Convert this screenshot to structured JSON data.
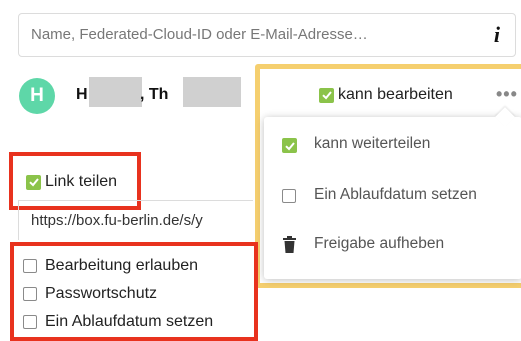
{
  "search": {
    "placeholder": "Name, Federated-Cloud-ID oder E-Mail-Adresse…",
    "info_glyph": "i"
  },
  "share": {
    "avatar_initial": "H",
    "name_first": "H",
    "name_comma": ", Th",
    "can_edit_label": "kann bearbeiten",
    "more_glyph": "•••"
  },
  "menu": {
    "items": [
      {
        "label": "kann weiterteilen",
        "checked": true
      },
      {
        "label": "Ein Ablaufdatum setzen",
        "checked": false
      },
      {
        "label": "Freigabe aufheben",
        "icon": "trash-icon"
      }
    ]
  },
  "link": {
    "share_label": "Link teilen",
    "url": "https://box.fu-berlin.de/s/y",
    "options": [
      {
        "label": "Bearbeitung erlauben",
        "checked": false
      },
      {
        "label": "Passwortschutz",
        "checked": false
      },
      {
        "label": "Ein Ablaufdatum setzen",
        "checked": false
      }
    ]
  },
  "colors": {
    "checkbox_green": "#8bc34a",
    "avatar_green": "#5ed7a8",
    "highlight_yellow": "#f5cf6f",
    "highlight_red": "#e8321e"
  }
}
